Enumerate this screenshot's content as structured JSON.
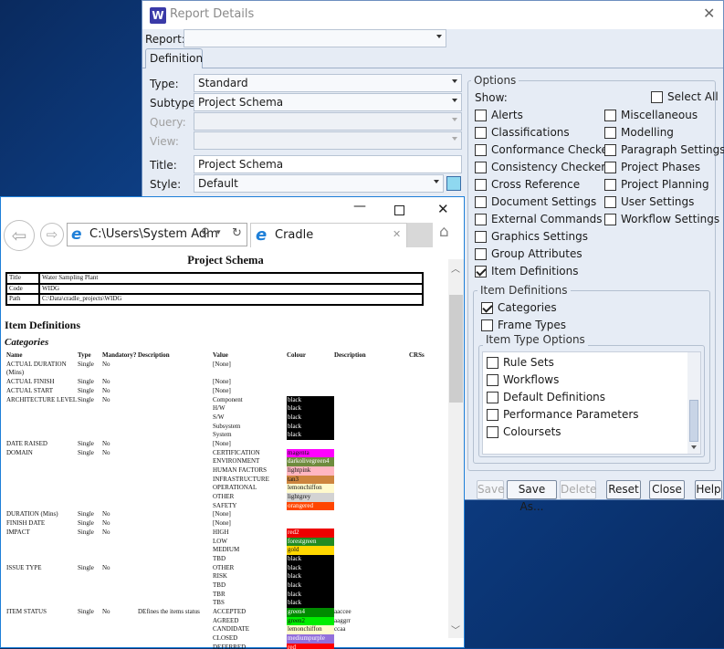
{
  "dialog": {
    "title": "Report Details",
    "logo": "W",
    "close": "✕",
    "report_label": "Report:",
    "report_value": "",
    "tab": "Definition",
    "type_label": "Type:",
    "type_value": "Standard",
    "subtype_label": "Subtype:",
    "subtype_value": "Project Schema",
    "query_label": "Query:",
    "view_label": "View:",
    "title_label": "Title:",
    "title_value": "Project Schema",
    "style_label": "Style:",
    "style_value": "Default",
    "options": {
      "legend": "Options",
      "show_label": "Show:",
      "select_all": "Select All",
      "left": [
        {
          "label": "Alerts",
          "checked": false
        },
        {
          "label": "Classifications",
          "checked": false
        },
        {
          "label": "Conformance Checker",
          "checked": false
        },
        {
          "label": "Consistency Checker",
          "checked": false
        },
        {
          "label": "Cross Reference",
          "checked": false
        },
        {
          "label": "Document Settings",
          "checked": false
        },
        {
          "label": "External Commands",
          "checked": false
        },
        {
          "label": "Graphics Settings",
          "checked": false
        },
        {
          "label": "Group Attributes",
          "checked": false
        },
        {
          "label": "Item Definitions",
          "checked": true
        }
      ],
      "right": [
        {
          "label": "Miscellaneous",
          "checked": false
        },
        {
          "label": "Modelling",
          "checked": false
        },
        {
          "label": "Paragraph Settings",
          "checked": false
        },
        {
          "label": "Project Phases",
          "checked": false
        },
        {
          "label": "Project Planning",
          "checked": false
        },
        {
          "label": "User Settings",
          "checked": false
        },
        {
          "label": "Workflow Settings",
          "checked": false
        }
      ],
      "item_definitions": {
        "legend": "Item Definitions",
        "items": [
          {
            "label": "Categories",
            "checked": true
          },
          {
            "label": "Frame Types",
            "checked": false
          }
        ],
        "item_type_options": {
          "legend": "Item Type Options",
          "items": [
            {
              "label": "Rule Sets",
              "checked": false
            },
            {
              "label": "Workflows",
              "checked": false
            },
            {
              "label": "Default Definitions",
              "checked": false
            },
            {
              "label": "Performance Parameters",
              "checked": false
            },
            {
              "label": "Coloursets",
              "checked": false
            }
          ]
        }
      }
    },
    "buttons": {
      "save": "Save",
      "save_as": "Save As...",
      "delete": "Delete",
      "reset": "Reset",
      "close": "Close",
      "help": "Help"
    }
  },
  "browser": {
    "address": "C:\\Users\\System Adm",
    "tab_title": "Cradle",
    "minimize": "—",
    "maximize": "☐",
    "close": "✕",
    "tab_close": "✕",
    "report": {
      "title": "Project Schema",
      "info": [
        [
          "Title",
          "Water Sampling Plant"
        ],
        [
          "Code",
          "WIDG"
        ],
        [
          "Path",
          "C:\\Data\\cradle_projects\\WIDG"
        ]
      ],
      "section": "Item Definitions",
      "subsection": "Categories",
      "headers": [
        "Name",
        "Type",
        "Mandatory?",
        "Description",
        "Value",
        "Colour",
        "Description",
        "CRSs"
      ],
      "rows": [
        [
          "ACTUAL DURATION",
          "Single",
          "No",
          "",
          "[None]",
          "",
          "",
          ""
        ],
        [
          "(Mins)",
          "",
          "",
          "",
          "",
          "",
          "",
          ""
        ],
        [
          "ACTUAL FINISH",
          "Single",
          "No",
          "",
          "[None]",
          "",
          "",
          ""
        ],
        [
          "ACTUAL START",
          "Single",
          "No",
          "",
          "[None]",
          "",
          "",
          ""
        ],
        [
          "ARCHITECTURE LEVEL",
          "Single",
          "No",
          "",
          "Component",
          "black",
          "",
          ""
        ],
        [
          "",
          "",
          "",
          "",
          "H/W",
          "black",
          "",
          ""
        ],
        [
          "",
          "",
          "",
          "",
          "S/W",
          "black",
          "",
          ""
        ],
        [
          "",
          "",
          "",
          "",
          "Subsystem",
          "black",
          "",
          ""
        ],
        [
          "",
          "",
          "",
          "",
          "System",
          "black",
          "",
          ""
        ],
        [
          "DATE RAISED",
          "Single",
          "No",
          "",
          "[None]",
          "",
          "",
          ""
        ],
        [
          "DOMAIN",
          "Single",
          "No",
          "",
          "CERTIFICATION",
          "magenta",
          "",
          ""
        ],
        [
          "",
          "",
          "",
          "",
          "ENVIRONMENT",
          "darkolivegreen4",
          "",
          ""
        ],
        [
          "",
          "",
          "",
          "",
          "HUMAN FACTORS",
          "lightpink",
          "",
          ""
        ],
        [
          "",
          "",
          "",
          "",
          "INFRASTRUCTURE",
          "tan3",
          "",
          ""
        ],
        [
          "",
          "",
          "",
          "",
          "OPERATIONAL",
          "lemonchiffon",
          "",
          ""
        ],
        [
          "",
          "",
          "",
          "",
          "OTHER",
          "lightgrey",
          "",
          ""
        ],
        [
          "",
          "",
          "",
          "",
          "SAFETY",
          "orangered",
          "",
          ""
        ],
        [
          "DURATION (Mins)",
          "Single",
          "No",
          "",
          "[None]",
          "",
          "",
          ""
        ],
        [
          "FINISH DATE",
          "Single",
          "No",
          "",
          "[None]",
          "",
          "",
          ""
        ],
        [
          "IMPACT",
          "Single",
          "No",
          "",
          "HIGH",
          "red2",
          "",
          ""
        ],
        [
          "",
          "",
          "",
          "",
          "LOW",
          "forestgreen",
          "",
          ""
        ],
        [
          "",
          "",
          "",
          "",
          "MEDIUM",
          "gold",
          "",
          ""
        ],
        [
          "",
          "",
          "",
          "",
          "TBD",
          "black",
          "",
          ""
        ],
        [
          "ISSUE TYPE",
          "Single",
          "No",
          "",
          "OTHER",
          "black",
          "",
          ""
        ],
        [
          "",
          "",
          "",
          "",
          "RISK",
          "black",
          "",
          ""
        ],
        [
          "",
          "",
          "",
          "",
          "TBD",
          "black",
          "",
          ""
        ],
        [
          "",
          "",
          "",
          "",
          "TBR",
          "black",
          "",
          ""
        ],
        [
          "",
          "",
          "",
          "",
          "TBS",
          "black",
          "",
          ""
        ],
        [
          "ITEM STATUS",
          "Single",
          "No",
          "DEfines the items status",
          "ACCEPTED",
          "green4",
          "aaccee",
          ""
        ],
        [
          "",
          "",
          "",
          "",
          "AGREED",
          "green2",
          "aaggrr",
          ""
        ],
        [
          "",
          "",
          "",
          "",
          "CANDIDATE",
          "lemonchiffon",
          "ccaa",
          ""
        ],
        [
          "",
          "",
          "",
          "",
          "CLOSED",
          "mediumpurple",
          "",
          ""
        ],
        [
          "",
          "",
          "",
          "",
          "DEFERRED",
          "red",
          "",
          ""
        ]
      ]
    }
  },
  "colors": {
    "black": "#000000",
    "magenta": "#ff00ff",
    "darkolivegreen4": "#6e8b3d",
    "lightpink": "#ffb6c1",
    "tan3": "#cd853f",
    "lemonchiffon": "#fffacd",
    "lightgrey": "#d3d3d3",
    "orangered": "#ff4500",
    "red2": "#ee0000",
    "forestgreen": "#228b22",
    "gold": "#ffd700",
    "green4": "#008b00",
    "green2": "#00ee00",
    "mediumpurple": "#9370db",
    "red": "#ff0000"
  }
}
